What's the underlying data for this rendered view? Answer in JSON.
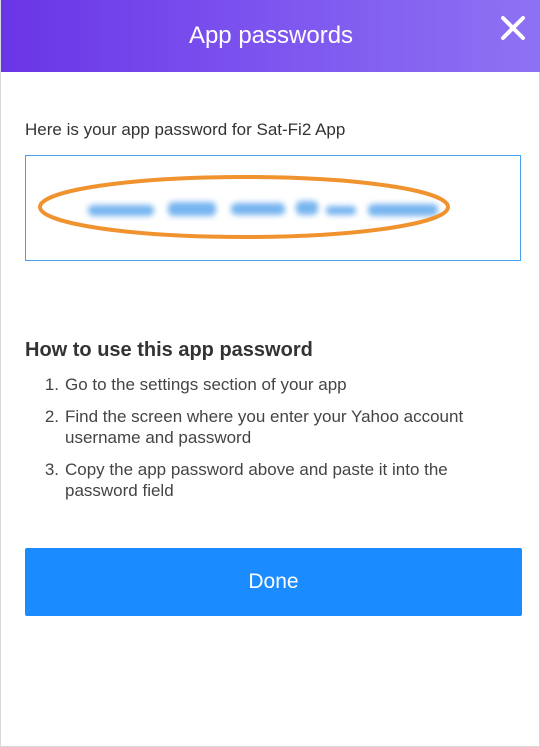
{
  "header": {
    "title": "App passwords",
    "close_icon": "close-icon"
  },
  "content": {
    "intro_text": "Here is your app password for Sat-Fi2 App",
    "password_value_note": "redacted-blurred",
    "highlight_color": "#f0922e",
    "howto_title": "How to use this app password",
    "steps": [
      {
        "num": "1.",
        "text": "Go to the settings section of your app"
      },
      {
        "num": "2.",
        "text": "Find the screen where you enter your Yahoo account username and password"
      },
      {
        "num": "3.",
        "text": "Copy the app password above and paste it into the password field"
      }
    ],
    "done_label": "Done"
  },
  "colors": {
    "header_start": "#6a35e6",
    "header_end": "#8e72f3",
    "primary_button": "#1a8cff",
    "field_border": "#4aa0ea"
  }
}
